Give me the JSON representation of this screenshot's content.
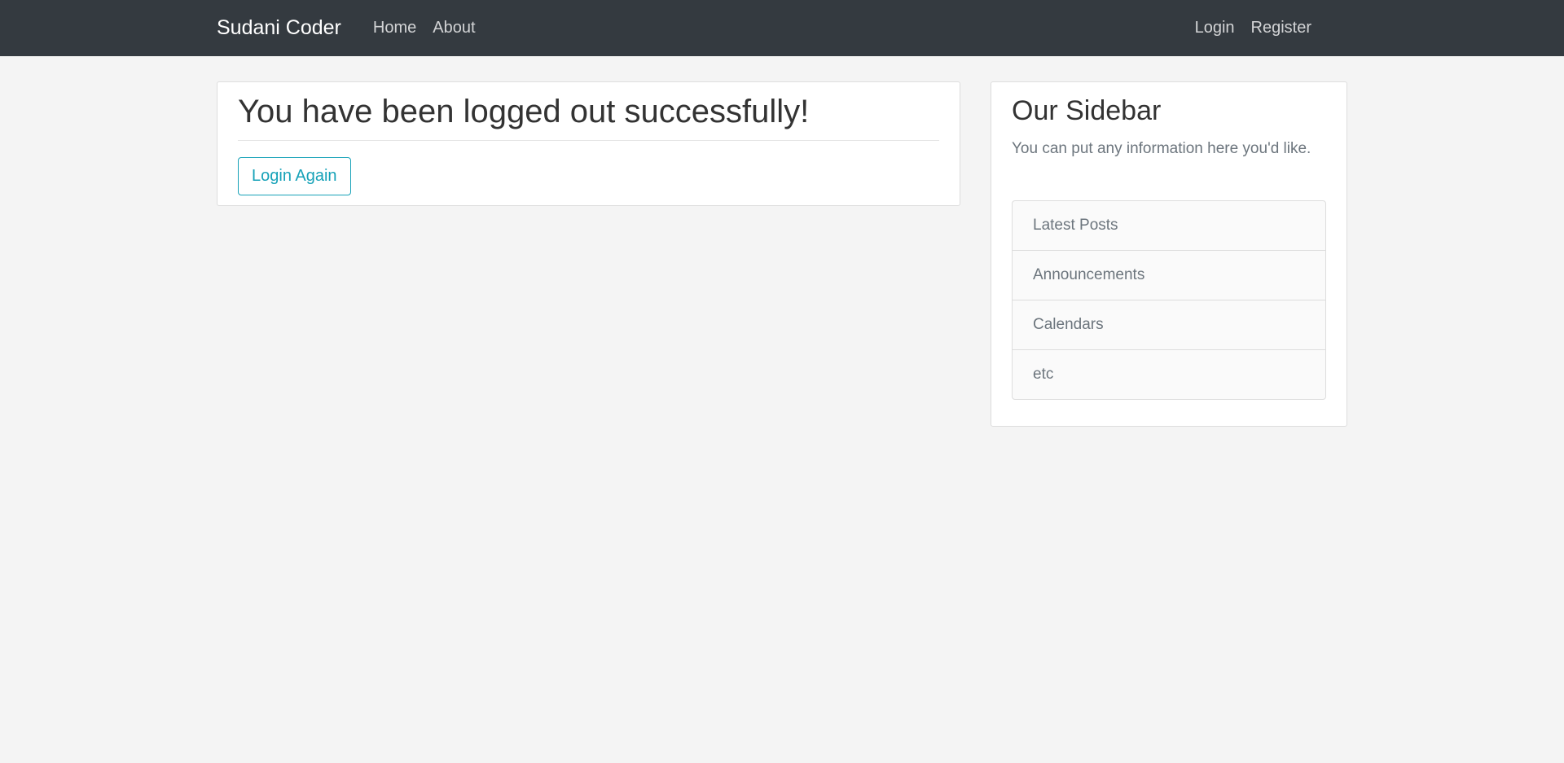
{
  "navbar": {
    "brand": "Sudani Coder",
    "links": [
      "Home",
      "About"
    ],
    "right_links": [
      "Login",
      "Register"
    ]
  },
  "main": {
    "title": "You have been logged out successfully!",
    "button_label": "Login Again"
  },
  "sidebar": {
    "title": "Our Sidebar",
    "text": "You can put any information here you'd like.",
    "items": [
      "Latest Posts",
      "Announcements",
      "Calendars",
      "etc"
    ]
  },
  "colors": {
    "navbar_bg": "#343a40",
    "page_bg": "#f4f4f4",
    "accent": "#17a2b8"
  }
}
